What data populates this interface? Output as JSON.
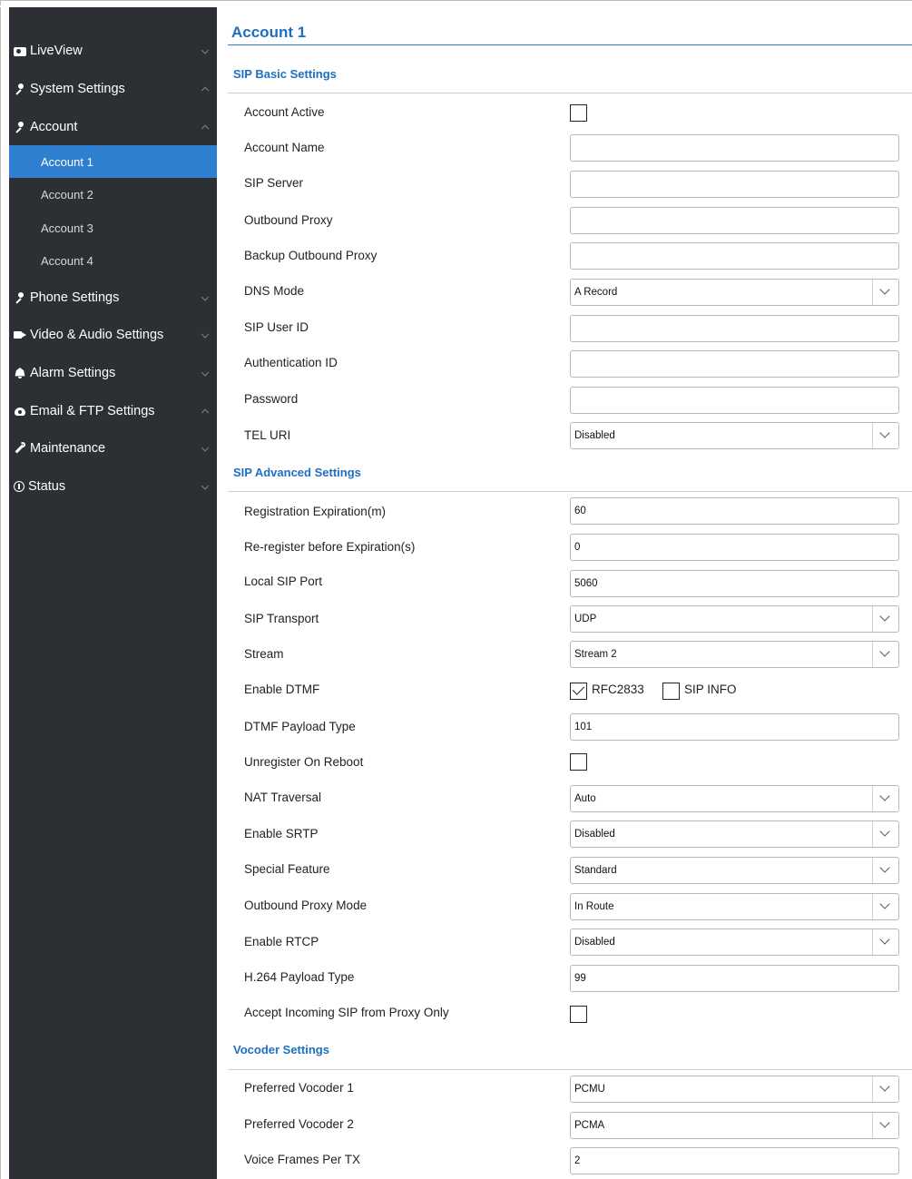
{
  "sidebar": {
    "items": [
      {
        "label": "LiveView",
        "icon": "camera-icon",
        "expanded": false
      },
      {
        "label": "System Settings",
        "icon": "key-icon",
        "expanded": true
      },
      {
        "label": "Account",
        "icon": "key-icon",
        "expanded": true
      },
      {
        "label": "Phone Settings",
        "icon": "key-icon",
        "expanded": false
      },
      {
        "label": "Video & Audio Settings",
        "icon": "video-icon",
        "expanded": false
      },
      {
        "label": "Alarm Settings",
        "icon": "bell-icon",
        "expanded": false
      },
      {
        "label": "Email & FTP Settings",
        "icon": "cloud-icon",
        "expanded": true
      },
      {
        "label": "Maintenance",
        "icon": "wrench-icon",
        "expanded": false
      },
      {
        "label": "Status",
        "icon": "info-icon",
        "expanded": false
      }
    ],
    "account_sub": [
      "Account 1",
      "Account 2",
      "Account 3",
      "Account 4"
    ],
    "active_sub": "Account 1"
  },
  "page": {
    "title": "Account 1"
  },
  "sections": {
    "basic": "SIP Basic Settings",
    "advanced": "SIP Advanced Settings",
    "vocoder": "Vocoder Settings"
  },
  "basic": {
    "account_active": {
      "label": "Account Active",
      "checked": false
    },
    "account_name": {
      "label": "Account Name",
      "value": ""
    },
    "sip_server": {
      "label": "SIP Server",
      "value": ""
    },
    "outbound_proxy": {
      "label": "Outbound Proxy",
      "value": ""
    },
    "backup_outbound_proxy": {
      "label": "Backup Outbound Proxy",
      "value": ""
    },
    "dns_mode": {
      "label": "DNS Mode",
      "value": "A Record"
    },
    "sip_user_id": {
      "label": "SIP User ID",
      "value": ""
    },
    "authentication_id": {
      "label": "Authentication ID",
      "value": ""
    },
    "password": {
      "label": "Password",
      "value": ""
    },
    "tel_uri": {
      "label": "TEL URI",
      "value": "Disabled"
    }
  },
  "advanced": {
    "registration_expiration": {
      "label": "Registration Expiration(m)",
      "value": "60"
    },
    "reregister": {
      "label": "Re-register before Expiration(s)",
      "value": "0"
    },
    "local_sip_port": {
      "label": "Local SIP Port",
      "value": "5060"
    },
    "sip_transport": {
      "label": "SIP Transport",
      "value": "UDP"
    },
    "stream": {
      "label": "Stream",
      "value": "Stream 2"
    },
    "enable_dtmf": {
      "label": "Enable DTMF",
      "rfc2833_label": "RFC2833",
      "rfc2833_checked": true,
      "sipinfo_label": "SIP INFO",
      "sipinfo_checked": false
    },
    "dtmf_payload_type": {
      "label": "DTMF Payload Type",
      "value": "101"
    },
    "unregister_on_reboot": {
      "label": "Unregister On Reboot",
      "checked": false
    },
    "nat_traversal": {
      "label": "NAT Traversal",
      "value": "Auto"
    },
    "enable_srtp": {
      "label": "Enable SRTP",
      "value": "Disabled"
    },
    "special_feature": {
      "label": "Special Feature",
      "value": "Standard"
    },
    "outbound_proxy_mode": {
      "label": "Outbound Proxy Mode",
      "value": "In Route"
    },
    "enable_rtcp": {
      "label": "Enable RTCP",
      "value": "Disabled"
    },
    "h264_payload_type": {
      "label": "H.264 Payload Type",
      "value": "99"
    },
    "accept_incoming_sip": {
      "label": "Accept Incoming SIP from Proxy Only",
      "checked": false
    }
  },
  "vocoder": {
    "preferred_vocoder_1": {
      "label": "Preferred Vocoder 1",
      "value": "PCMU"
    },
    "preferred_vocoder_2": {
      "label": "Preferred Vocoder 2",
      "value": "PCMA"
    },
    "voice_frames_per_tx": {
      "label": "Voice Frames Per TX",
      "value": "2"
    }
  },
  "colors": {
    "sidebar_bg": "#2c3035",
    "active_bg": "#2f7fd1",
    "heading": "#1d6fc3"
  }
}
